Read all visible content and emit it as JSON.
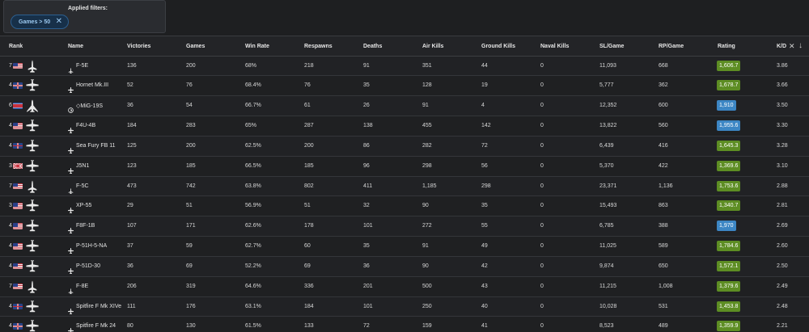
{
  "filters": {
    "title": "Applied filters:",
    "chips": [
      {
        "label": "Games > 50"
      }
    ]
  },
  "table": {
    "columns": [
      {
        "key": "rank",
        "label": "Rank"
      },
      {
        "key": "name",
        "label": "Name"
      },
      {
        "key": "victories",
        "label": "Victories"
      },
      {
        "key": "games",
        "label": "Games"
      },
      {
        "key": "win_rate",
        "label": "Win Rate"
      },
      {
        "key": "respawns",
        "label": "Respawns"
      },
      {
        "key": "deaths",
        "label": "Deaths"
      },
      {
        "key": "air_kills",
        "label": "Air Kills"
      },
      {
        "key": "ground_kills",
        "label": "Ground Kills"
      },
      {
        "key": "naval_kills",
        "label": "Naval Kills"
      },
      {
        "key": "sl_game",
        "label": "SL/Game"
      },
      {
        "key": "rp_game",
        "label": "RP/Game"
      },
      {
        "key": "rating",
        "label": "Rating"
      },
      {
        "key": "kd",
        "label": "K/D"
      }
    ],
    "rows": [
      {
        "rank": "7",
        "nation": "us",
        "plane": "jet",
        "name_icon": "jet",
        "name": "F-5E",
        "victories": "136",
        "games": "200",
        "win_rate": "68%",
        "respawns": "218",
        "deaths": "91",
        "air_kills": "351",
        "ground_kills": "44",
        "naval_kills": "0",
        "sl_game": "11,093",
        "rp_game": "668",
        "rating": "1,606.7",
        "rating_color": "green",
        "kd": "3.86"
      },
      {
        "rank": "4",
        "nation": "gb",
        "plane": "prop",
        "name_icon": "prop",
        "name": "Hornet Mk.III",
        "victories": "52",
        "games": "76",
        "win_rate": "68.4%",
        "respawns": "76",
        "deaths": "35",
        "air_kills": "128",
        "ground_kills": "19",
        "naval_kills": "0",
        "sl_game": "5,777",
        "rp_game": "362",
        "rating": "1,678.7",
        "rating_color": "green",
        "kd": "3.66"
      },
      {
        "rank": "6",
        "nation": "kp",
        "plane": "swept",
        "name_icon": "premium",
        "name": "◇MiG-19S",
        "victories": "36",
        "games": "54",
        "win_rate": "66.7%",
        "respawns": "61",
        "deaths": "26",
        "air_kills": "91",
        "ground_kills": "4",
        "naval_kills": "0",
        "sl_game": "12,352",
        "rp_game": "600",
        "rating": "1,910",
        "rating_color": "blue",
        "kd": "3.50"
      },
      {
        "rank": "4",
        "nation": "us",
        "plane": "prop",
        "name_icon": "prop",
        "name": "F4U-4B",
        "victories": "184",
        "games": "283",
        "win_rate": "65%",
        "respawns": "287",
        "deaths": "138",
        "air_kills": "455",
        "ground_kills": "142",
        "naval_kills": "0",
        "sl_game": "13,822",
        "rp_game": "560",
        "rating": "1,955.6",
        "rating_color": "blue",
        "kd": "3.30"
      },
      {
        "rank": "4",
        "nation": "gb",
        "plane": "prop",
        "name_icon": "prop",
        "name": "Sea Fury FB 11",
        "victories": "125",
        "games": "200",
        "win_rate": "62.5%",
        "respawns": "200",
        "deaths": "86",
        "air_kills": "282",
        "ground_kills": "72",
        "naval_kills": "0",
        "sl_game": "6,439",
        "rp_game": "416",
        "rating": "1,645.3",
        "rating_color": "green",
        "kd": "3.28"
      },
      {
        "rank": "3",
        "nation": "jp",
        "plane": "prop",
        "name_icon": "prop",
        "name": "J5N1",
        "victories": "123",
        "games": "185",
        "win_rate": "66.5%",
        "respawns": "185",
        "deaths": "96",
        "air_kills": "298",
        "ground_kills": "56",
        "naval_kills": "0",
        "sl_game": "5,370",
        "rp_game": "422",
        "rating": "1,369.6",
        "rating_color": "green",
        "kd": "3.10"
      },
      {
        "rank": "7",
        "nation": "us",
        "plane": "jet",
        "name_icon": "jet",
        "name": "F-5C",
        "victories": "473",
        "games": "742",
        "win_rate": "63.8%",
        "respawns": "802",
        "deaths": "411",
        "air_kills": "1,185",
        "ground_kills": "298",
        "naval_kills": "0",
        "sl_game": "23,371",
        "rp_game": "1,136",
        "rating": "1,753.6",
        "rating_color": "green",
        "kd": "2.88"
      },
      {
        "rank": "3",
        "nation": "us",
        "plane": "prop",
        "name_icon": "prop",
        "name": "XP-55",
        "victories": "29",
        "games": "51",
        "win_rate": "56.9%",
        "respawns": "51",
        "deaths": "32",
        "air_kills": "90",
        "ground_kills": "35",
        "naval_kills": "0",
        "sl_game": "15,493",
        "rp_game": "863",
        "rating": "1,340.7",
        "rating_color": "green",
        "kd": "2.81"
      },
      {
        "rank": "4",
        "nation": "us",
        "plane": "prop",
        "name_icon": "prop",
        "name": "F8F-1B",
        "victories": "107",
        "games": "171",
        "win_rate": "62.6%",
        "respawns": "178",
        "deaths": "101",
        "air_kills": "272",
        "ground_kills": "55",
        "naval_kills": "0",
        "sl_game": "6,785",
        "rp_game": "388",
        "rating": "1,970",
        "rating_color": "blue",
        "kd": "2.69"
      },
      {
        "rank": "4",
        "nation": "us",
        "plane": "prop",
        "name_icon": "prop",
        "name": "P-51H-5-NA",
        "victories": "37",
        "games": "59",
        "win_rate": "62.7%",
        "respawns": "60",
        "deaths": "35",
        "air_kills": "91",
        "ground_kills": "49",
        "naval_kills": "0",
        "sl_game": "11,025",
        "rp_game": "589",
        "rating": "1,784.6",
        "rating_color": "green",
        "kd": "2.60"
      },
      {
        "rank": "4",
        "nation": "us",
        "plane": "prop",
        "name_icon": "prop",
        "name": "P-51D-30",
        "victories": "36",
        "games": "69",
        "win_rate": "52.2%",
        "respawns": "69",
        "deaths": "36",
        "air_kills": "90",
        "ground_kills": "42",
        "naval_kills": "0",
        "sl_game": "9,874",
        "rp_game": "650",
        "rating": "1,572.1",
        "rating_color": "green",
        "kd": "2.50"
      },
      {
        "rank": "7",
        "nation": "us",
        "plane": "jet",
        "name_icon": "jet",
        "name": "F-8E",
        "victories": "206",
        "games": "319",
        "win_rate": "64.6%",
        "respawns": "336",
        "deaths": "201",
        "air_kills": "500",
        "ground_kills": "43",
        "naval_kills": "0",
        "sl_game": "11,215",
        "rp_game": "1,008",
        "rating": "1,379.6",
        "rating_color": "green",
        "kd": "2.49"
      },
      {
        "rank": "4",
        "nation": "gb",
        "plane": "prop",
        "name_icon": "prop",
        "name": "Spitfire F Mk XIVe",
        "victories": "111",
        "games": "176",
        "win_rate": "63.1%",
        "respawns": "184",
        "deaths": "101",
        "air_kills": "250",
        "ground_kills": "40",
        "naval_kills": "0",
        "sl_game": "10,028",
        "rp_game": "531",
        "rating": "1,453.8",
        "rating_color": "green",
        "kd": "2.48"
      },
      {
        "rank": "4",
        "nation": "gb",
        "plane": "prop",
        "name_icon": "prop",
        "name": "Spitfire F Mk 24",
        "victories": "80",
        "games": "130",
        "win_rate": "61.5%",
        "respawns": "133",
        "deaths": "72",
        "air_kills": "159",
        "ground_kills": "41",
        "naval_kills": "0",
        "sl_game": "8,523",
        "rp_game": "489",
        "rating": "1,359.9",
        "rating_color": "green",
        "kd": "2.21"
      }
    ]
  },
  "colors": {
    "green": "#5d8d23",
    "blue": "#3c86c4"
  }
}
